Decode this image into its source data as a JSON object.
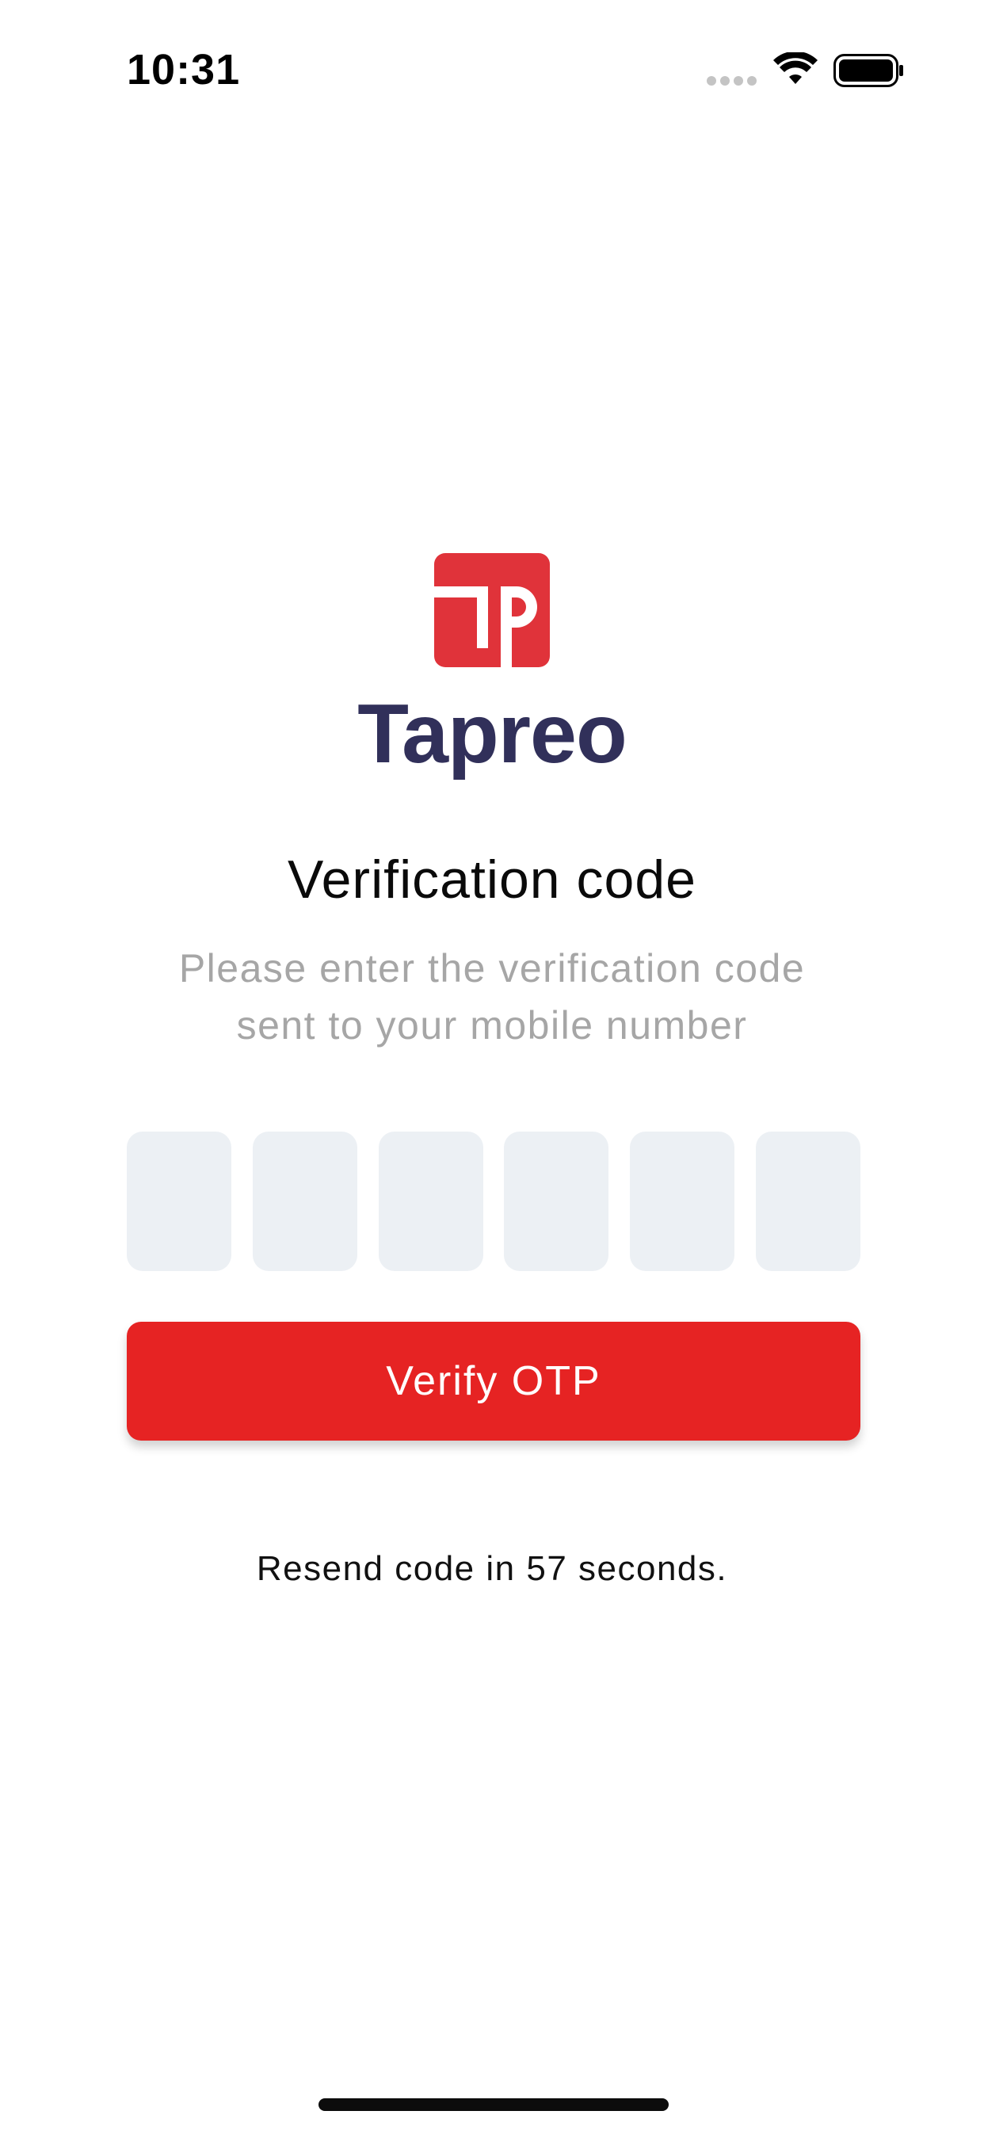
{
  "status_bar": {
    "time": "10:31",
    "icons": [
      "signal-icon",
      "wifi-icon",
      "battery-icon"
    ]
  },
  "brand": {
    "name": "Tapreo",
    "logo_icon": "tapreo-logo-icon",
    "logo_color": "#e0333a",
    "name_color": "#31305a"
  },
  "verification": {
    "title": "Verification code",
    "subtitle_line1": "Please enter the verification code",
    "subtitle_line2": "sent to your mobile number"
  },
  "otp": {
    "digit_count": 6,
    "values": [
      "",
      "",
      "",
      "",
      "",
      ""
    ],
    "box_color": "#ecf0f4"
  },
  "verify_button": {
    "label": "Verify OTP",
    "color": "#e62323"
  },
  "resend": {
    "text": "Resend code in 57 seconds."
  }
}
